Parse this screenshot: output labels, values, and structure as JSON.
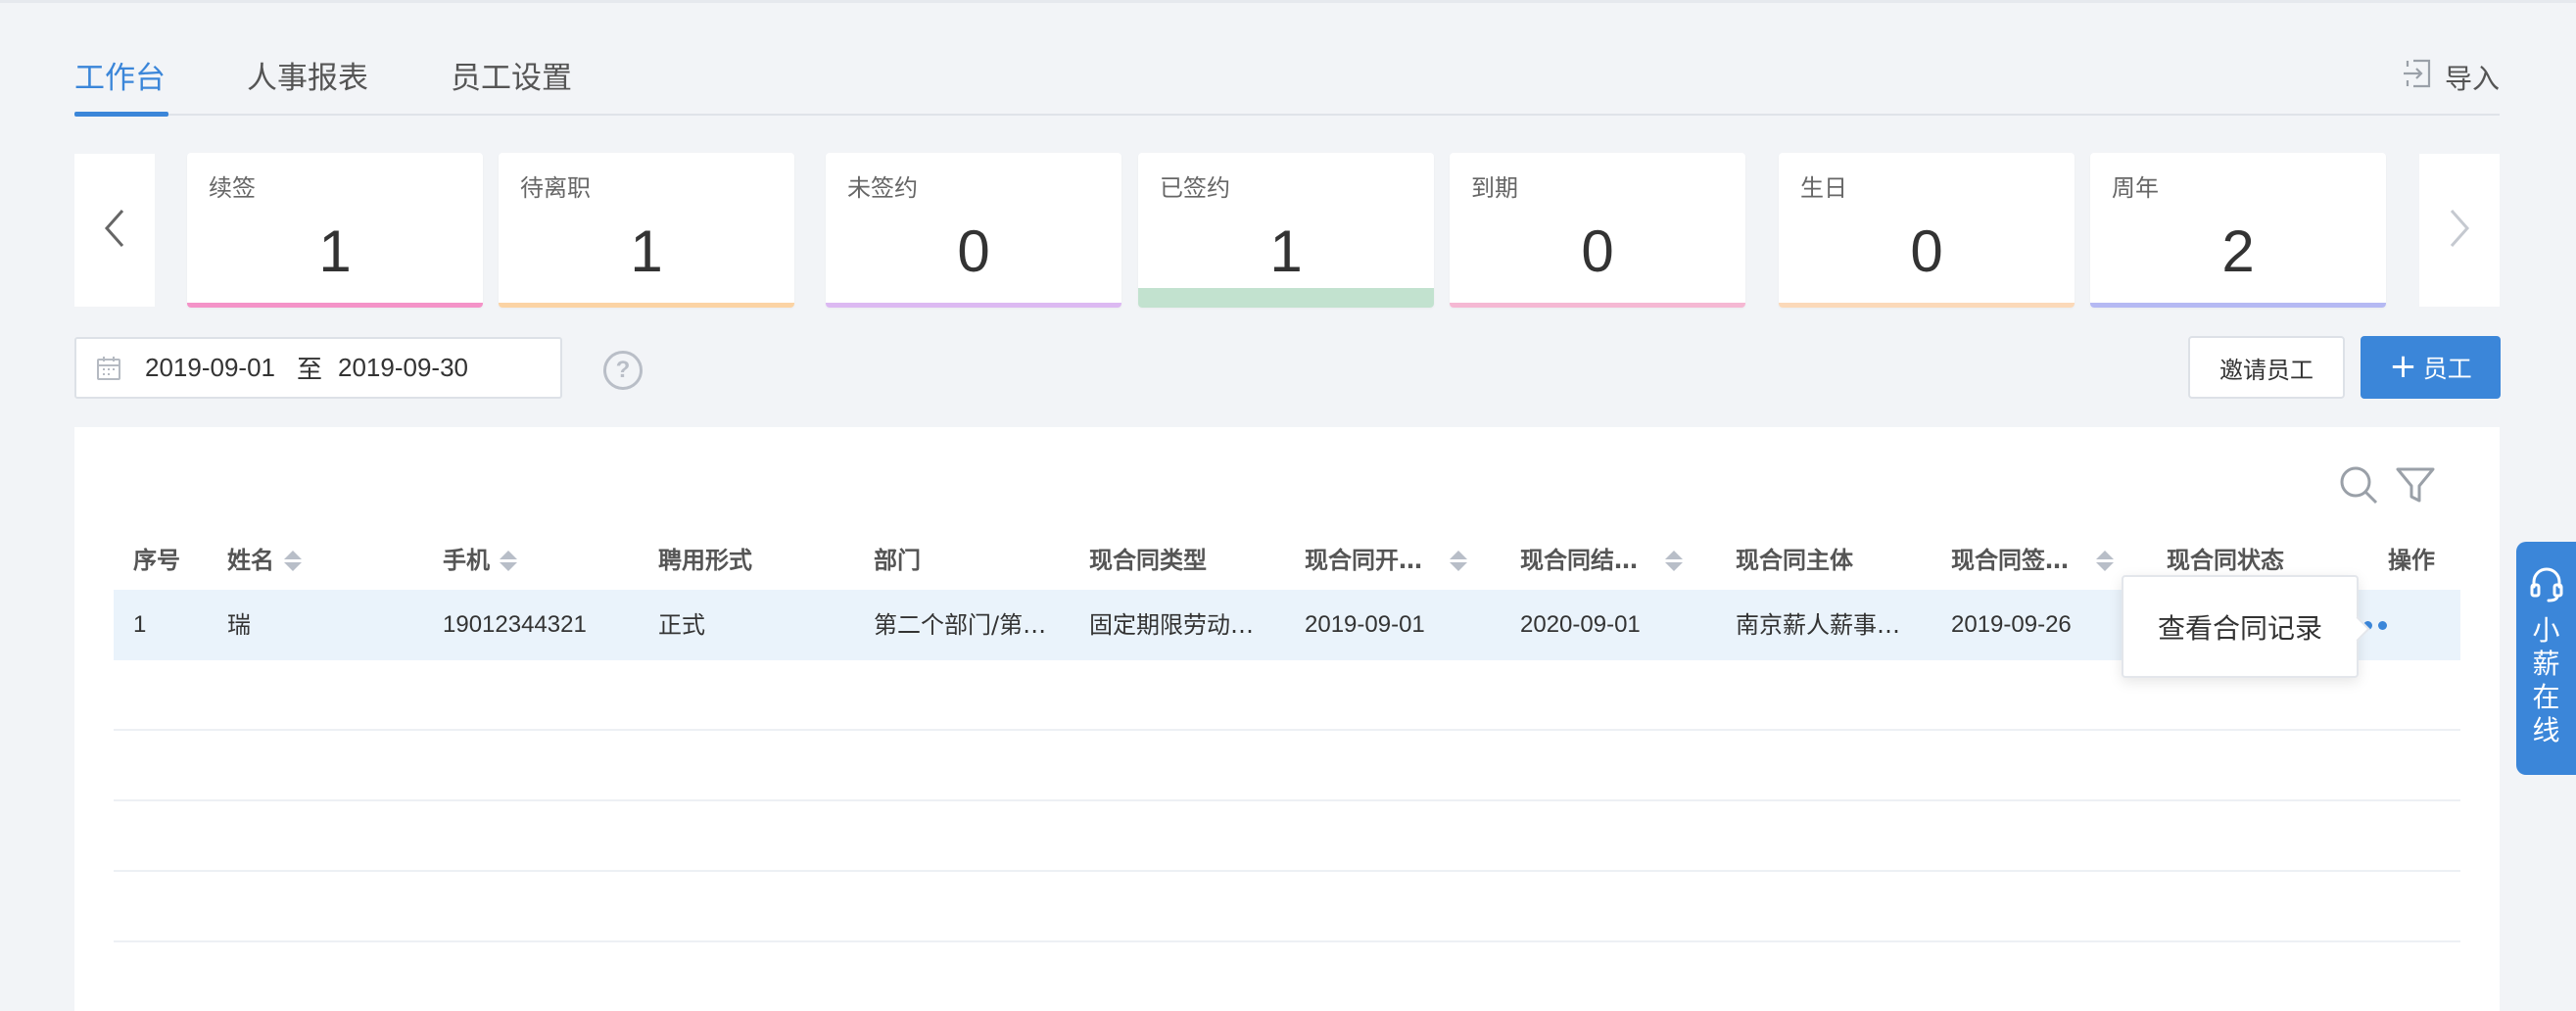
{
  "tabs": [
    {
      "label": "工作台",
      "active": true
    },
    {
      "label": "人事报表",
      "active": false
    },
    {
      "label": "员工设置",
      "active": false
    }
  ],
  "import_label": "导入",
  "cards": [
    {
      "label": "续签",
      "value": "1",
      "color": "#f493c8"
    },
    {
      "label": "待离职",
      "value": "1",
      "color": "#fbd3a4"
    },
    {
      "label": "未签约",
      "value": "0",
      "color": "#dcb9f2"
    },
    {
      "label": "已签约",
      "value": "1",
      "color": "#c2e2cf"
    },
    {
      "label": "到期",
      "value": "0",
      "color": "#f5b8d3"
    },
    {
      "label": "生日",
      "value": "0",
      "color": "#fbd9b9"
    },
    {
      "label": "周年",
      "value": "2",
      "color": "#b5b9f3"
    }
  ],
  "date_range": {
    "start": "2019-09-01",
    "separator": "至",
    "end": "2019-09-30"
  },
  "help_label": "?",
  "buttons": {
    "invite": "邀请员工",
    "add_plus": "+",
    "add": "员工"
  },
  "table": {
    "columns": [
      "序号",
      "姓名",
      "手机",
      "聘用形式",
      "部门",
      "现合同类型",
      "现合同开…",
      "现合同结…",
      "现合同主体",
      "现合同签…",
      "现合同状态",
      "操作"
    ],
    "rows": [
      {
        "index": "1",
        "name": "瑞",
        "phone": "19012344321",
        "employment": "正式",
        "dept": "第二个部门/第…",
        "contract_type": "固定期限劳动…",
        "contract_start": "2019-09-01",
        "contract_end": "2020-09-01",
        "contract_entity": "南京薪人薪事…",
        "contract_signed": "2019-09-26"
      }
    ]
  },
  "popup": {
    "label": "查看合同记录"
  },
  "side_widget": {
    "label": "小薪在线"
  },
  "colors": {
    "accent": "#3b86d9"
  }
}
